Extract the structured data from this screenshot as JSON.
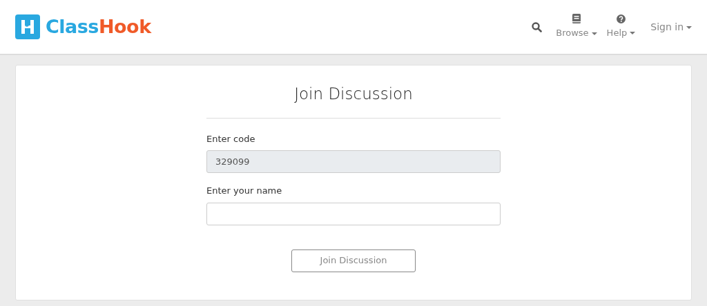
{
  "logo": {
    "parts": [
      {
        "text": "Class",
        "color": "#29a8e0"
      },
      {
        "text": "Hook",
        "color": "#f05a28"
      }
    ]
  },
  "nav": [
    {
      "kind": "search"
    },
    {
      "kind": "book",
      "label": "Browse"
    },
    {
      "kind": "help",
      "label": "Help"
    },
    {
      "kind": "plain",
      "label": "Sign in"
    }
  ],
  "form": {
    "title": "Join Discussion",
    "fields": [
      {
        "label": "Enter code",
        "value": "329099",
        "disabled": true
      },
      {
        "label": "Enter your name",
        "disabled": false
      }
    ],
    "button": {
      "label": "Join Discussion",
      "disabled": true
    }
  }
}
